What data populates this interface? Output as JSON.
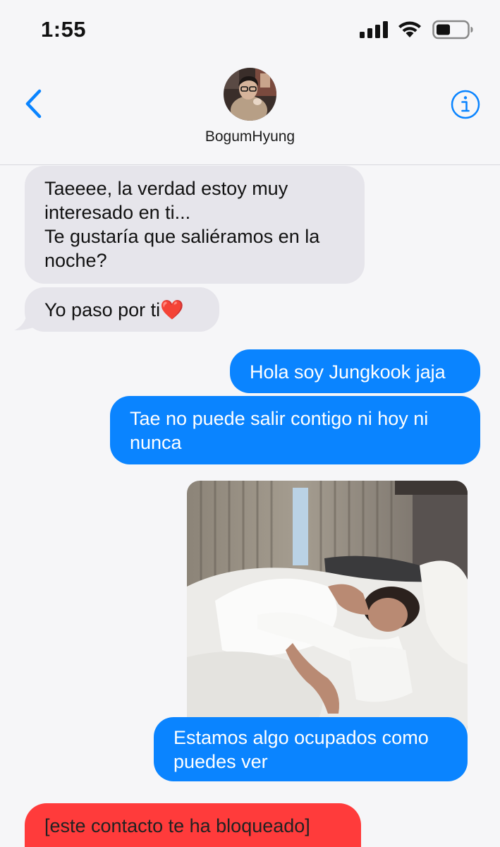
{
  "status": {
    "time": "1:55"
  },
  "header": {
    "contact_name": "BogumHyung"
  },
  "messages": [
    {
      "direction": "incoming",
      "lines": [
        "Taeeee, la verdad estoy muy",
        "interesado en ti...",
        "Te gustaría que saliéramos en la",
        "noche?"
      ]
    },
    {
      "direction": "incoming",
      "text": "Yo paso por ti❤️"
    },
    {
      "direction": "outgoing",
      "text": "Hola soy Jungkook jaja"
    },
    {
      "direction": "outgoing",
      "lines": [
        "Tae no puede salir contigo ni hoy ni",
        "nunca"
      ]
    },
    {
      "direction": "outgoing",
      "type": "image",
      "image_description_icon": "photo"
    },
    {
      "direction": "outgoing",
      "lines": [
        "Estamos algo ocupados como",
        "puedes ver"
      ]
    },
    {
      "direction": "system",
      "text": "[este contacto te ha bloqueado]"
    }
  ],
  "colors": {
    "outgoing": "#0a84ff",
    "incoming": "#e6e5eb",
    "blocked": "#ff3b3b",
    "accent": "#0a84ff"
  }
}
